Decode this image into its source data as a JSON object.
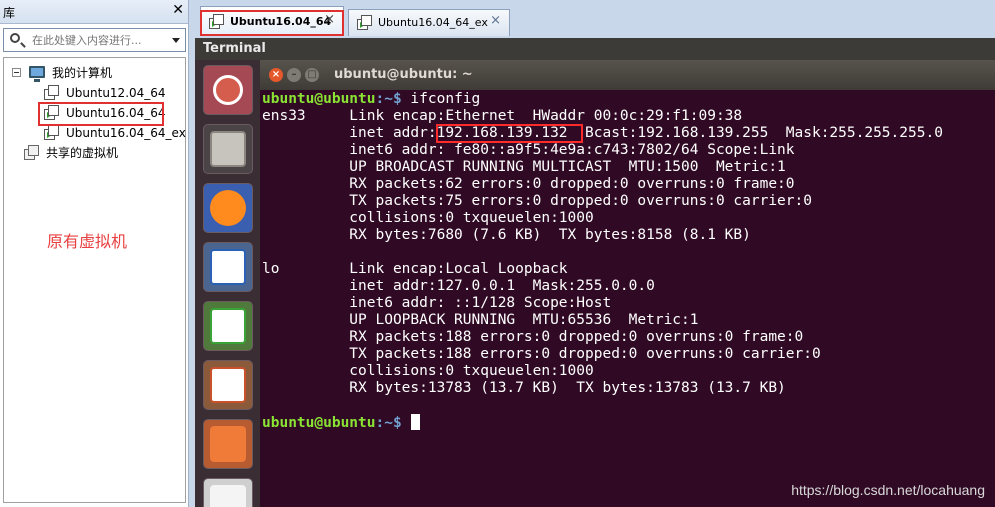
{
  "library": {
    "title": "库",
    "close_glyph": "✕",
    "search_placeholder": "在此处键入内容进行...",
    "tree": {
      "root_label": "我的计算机",
      "vms": [
        "Ubuntu12.04_64",
        "Ubuntu16.04_64",
        "Ubuntu16.04_64_ex"
      ],
      "shared_label": "共享的虚拟机"
    },
    "annotation": "原有虚拟机"
  },
  "tabs": [
    {
      "label": "Ubuntu16.04_64",
      "close": "×"
    },
    {
      "label": "Ubuntu16.04_64_ex",
      "close": "×"
    }
  ],
  "top_bar_title": "Terminal",
  "terminal": {
    "window_title": "ubuntu@ubuntu: ~",
    "prompt_user": "ubuntu@ubuntu",
    "prompt_path": ":~$",
    "command": " ifconfig",
    "lines": [
      "ens33     Link encap:Ethernet  HWaddr 00:0c:29:f1:09:38",
      "          inet addr:192.168.139.132  Bcast:192.168.139.255  Mask:255.255.255.0",
      "          inet6 addr: fe80::a9f5:4e9a:c743:7802/64 Scope:Link",
      "          UP BROADCAST RUNNING MULTICAST  MTU:1500  Metric:1",
      "          RX packets:62 errors:0 dropped:0 overruns:0 frame:0",
      "          TX packets:75 errors:0 dropped:0 overruns:0 carrier:0",
      "          collisions:0 txqueuelen:1000",
      "          RX bytes:7680 (7.6 KB)  TX bytes:8158 (8.1 KB)",
      "",
      "lo        Link encap:Local Loopback",
      "          inet addr:127.0.0.1  Mask:255.0.0.0",
      "          inet6 addr: ::1/128 Scope:Host",
      "          UP LOOPBACK RUNNING  MTU:65536  Metric:1",
      "          RX packets:188 errors:0 dropped:0 overruns:0 frame:0",
      "          TX packets:188 errors:0 dropped:0 overruns:0 carrier:0",
      "          collisions:0 txqueuelen:1000",
      "          RX bytes:13783 (13.7 KB)  TX bytes:13783 (13.7 KB)"
    ]
  },
  "launcher_icons": [
    "ubuntu-dash-icon",
    "files-icon",
    "firefox-icon",
    "writer-icon",
    "calc-icon",
    "impress-icon",
    "software-center-icon",
    "amazon-icon"
  ],
  "watermark": "https://blog.csdn.net/locahuang",
  "colors": {
    "terminal_bg": "#300a24",
    "prompt_user": "#8ae234",
    "prompt_path": "#729fcf",
    "highlight": "#e03030"
  }
}
